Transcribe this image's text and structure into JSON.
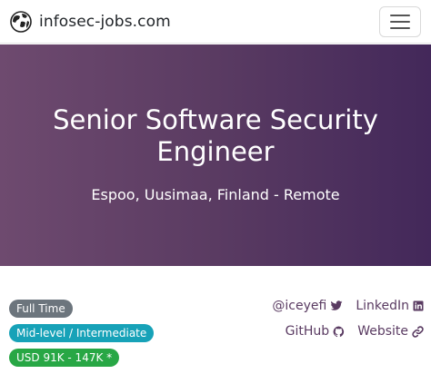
{
  "navbar": {
    "brand": "infosec-jobs.com",
    "logo_icon": "globe-logo-icon",
    "menu_icon": "hamburger-menu-icon"
  },
  "hero": {
    "title": "Senior Software Security Engineer",
    "location": "Espoo, Uusimaa, Finland - Remote"
  },
  "badges": {
    "type": "Full Time",
    "level": "Mid-level / Intermediate",
    "salary": "USD 91K - 147K *"
  },
  "links": {
    "twitter": "@iceyefi",
    "linkedin": "LinkedIn",
    "github": "GitHub",
    "website": "Website"
  },
  "colors": {
    "hero_gradient_start": "#6e4a6f",
    "hero_gradient_end": "#43285a",
    "link": "#5a3b62",
    "badge_type": "#6c757d",
    "badge_level": "#17a2b8",
    "badge_salary": "#28a745"
  }
}
